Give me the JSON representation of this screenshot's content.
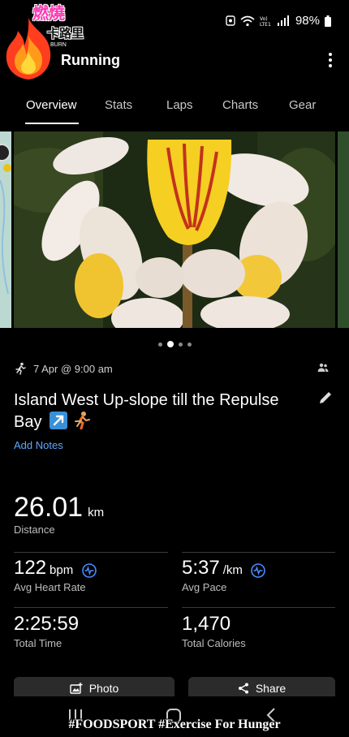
{
  "status_bar": {
    "battery": "98%",
    "network": "LTE1"
  },
  "logo": {
    "line1": "燃燒",
    "line2": "卡路里",
    "line3": "BURN"
  },
  "header": {
    "title": "Running",
    "menu_icon": "more-vert-icon"
  },
  "tabs": [
    {
      "label": "Overview",
      "active": true
    },
    {
      "label": "Stats",
      "active": false
    },
    {
      "label": "Laps",
      "active": false
    },
    {
      "label": "Charts",
      "active": false
    },
    {
      "label": "Gear",
      "active": false
    }
  ],
  "carousel": {
    "slide_count": 4,
    "active_index": 1
  },
  "activity": {
    "datetime": "7 Apr @ 9:00 am",
    "title": "Island West Up-slope till the Repulse Bay",
    "add_notes": "Add Notes"
  },
  "distance": {
    "value": "26.01",
    "unit": "km",
    "label": "Distance"
  },
  "stats": {
    "heart_rate": {
      "value": "122",
      "unit": "bpm",
      "label": "Avg Heart Rate"
    },
    "pace": {
      "value": "5:37",
      "unit": "/km",
      "label": "Avg Pace"
    },
    "time": {
      "value": "2:25:59",
      "label": "Total Time"
    },
    "calories": {
      "value": "1,470",
      "label": "Total Calories"
    }
  },
  "actions": {
    "photo": "Photo",
    "share": "Share"
  },
  "footer": {
    "tag": "#FOODSPORT #Exercise For Hunger"
  },
  "colors": {
    "accent_link": "#5ea9ff",
    "background": "#000000",
    "pulse_icon": "#4a8dff"
  }
}
